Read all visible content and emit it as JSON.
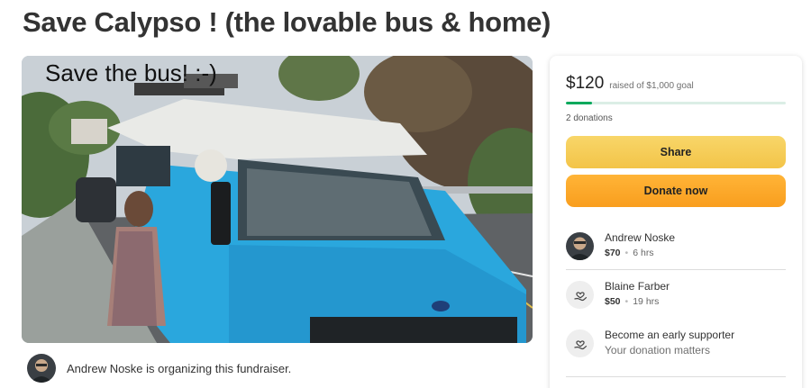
{
  "page": {
    "title": "Save Calypso ! (the lovable bus & home)"
  },
  "hero": {
    "caption": "Save the bus!  :-)"
  },
  "organizer": {
    "text": "Andrew Noske is organizing this fundraiser."
  },
  "donation_card": {
    "raised_amount": "$120",
    "goal_text": "raised of $1,000 goal",
    "progress_fraction": 0.12,
    "donation_count": "2 donations",
    "share_label": "Share",
    "donate_label": "Donate now",
    "donors": [
      {
        "name": "Andrew Noske",
        "amount": "$70",
        "time": "6 hrs",
        "icon": "avatar-photo"
      },
      {
        "name": "Blaine Farber",
        "amount": "$50",
        "time": "19 hrs",
        "icon": "heart-hand-icon"
      }
    ],
    "early_supporter": {
      "title": "Become an early supporter",
      "subtitle": "Your donation matters",
      "icon": "heart-hand-icon"
    }
  },
  "colors": {
    "progress_fill": "#02a95c",
    "share_button": "#f5cc52",
    "donate_button": "#fca72a",
    "bus_blue": "#2aa7dd"
  }
}
